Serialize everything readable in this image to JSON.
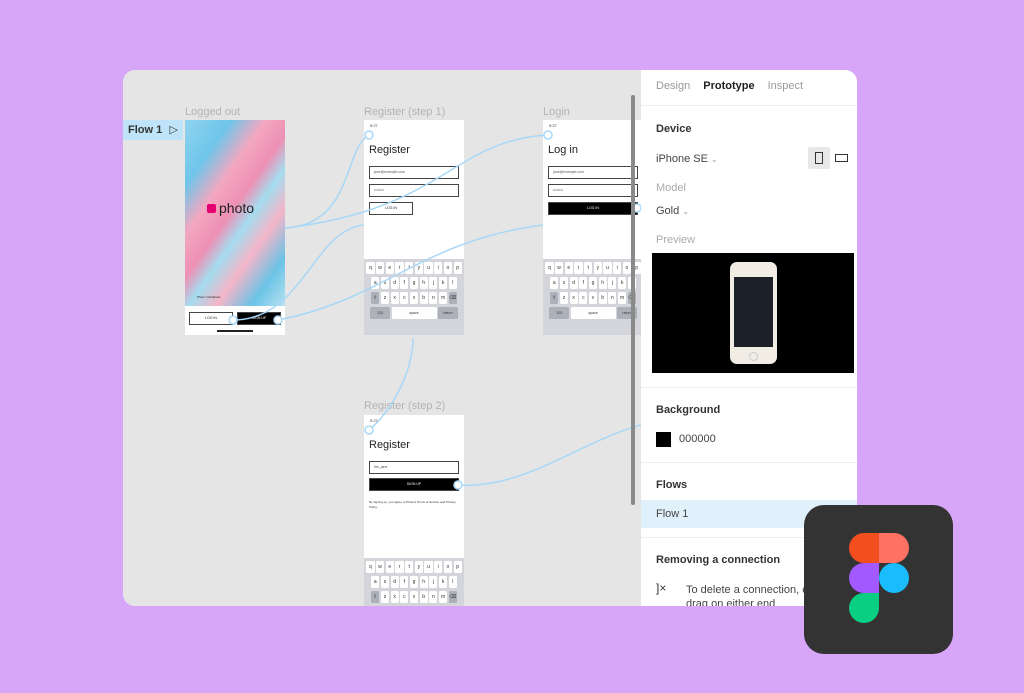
{
  "canvas": {
    "flow_badge": "Flow 1",
    "frames": {
      "logged_out": {
        "label": "Logged out",
        "brand": "photo",
        "credit": "Photo Contributor",
        "login": "LOG IN",
        "signup": "SIGN UP"
      },
      "register1": {
        "label": "Register (step 1)",
        "time": "9:27",
        "title": "Register",
        "email": "jane@example.com",
        "password": "••••••••",
        "button": "LOG IN"
      },
      "login": {
        "label": "Login",
        "time": "9:27",
        "title": "Log in",
        "email": "jane@example.com",
        "password": "••••••••",
        "button": "LOG IN"
      },
      "register2": {
        "label": "Register (step 2)",
        "time": "9:27",
        "title": "Register",
        "username": "fire_jane",
        "button": "SIGN UP",
        "terms": "By signing up, you agree to Photo's Terms of Service and Privacy Policy."
      }
    },
    "keyboard": {
      "row1": [
        "q",
        "w",
        "e",
        "r",
        "t",
        "y",
        "u",
        "i",
        "o",
        "p"
      ],
      "row2": [
        "a",
        "s",
        "d",
        "f",
        "g",
        "h",
        "j",
        "k",
        "l"
      ],
      "row3": [
        "z",
        "x",
        "c",
        "v",
        "b",
        "n",
        "m"
      ],
      "numbers": "123",
      "space": "space",
      "return": "return"
    },
    "connector_color": "#a8d8f7"
  },
  "panel": {
    "tabs": [
      "Design",
      "Prototype",
      "Inspect"
    ],
    "active_tab": "Prototype",
    "device": {
      "heading": "Device",
      "value": "iPhone SE",
      "model_label": "Model",
      "model_value": "Gold",
      "preview_label": "Preview",
      "orientation": "portrait"
    },
    "background": {
      "heading": "Background",
      "hex": "000000",
      "color": "#000000"
    },
    "flows": {
      "heading": "Flows",
      "items": [
        "Flow 1"
      ]
    },
    "help": {
      "heading": "Removing a connection",
      "text": "To delete a connection, click and drag on either end"
    }
  },
  "logo": {
    "name": "Figma",
    "colors": [
      "#f24e1e",
      "#ff7262",
      "#a259ff",
      "#1abcfe",
      "#0acf83"
    ]
  }
}
